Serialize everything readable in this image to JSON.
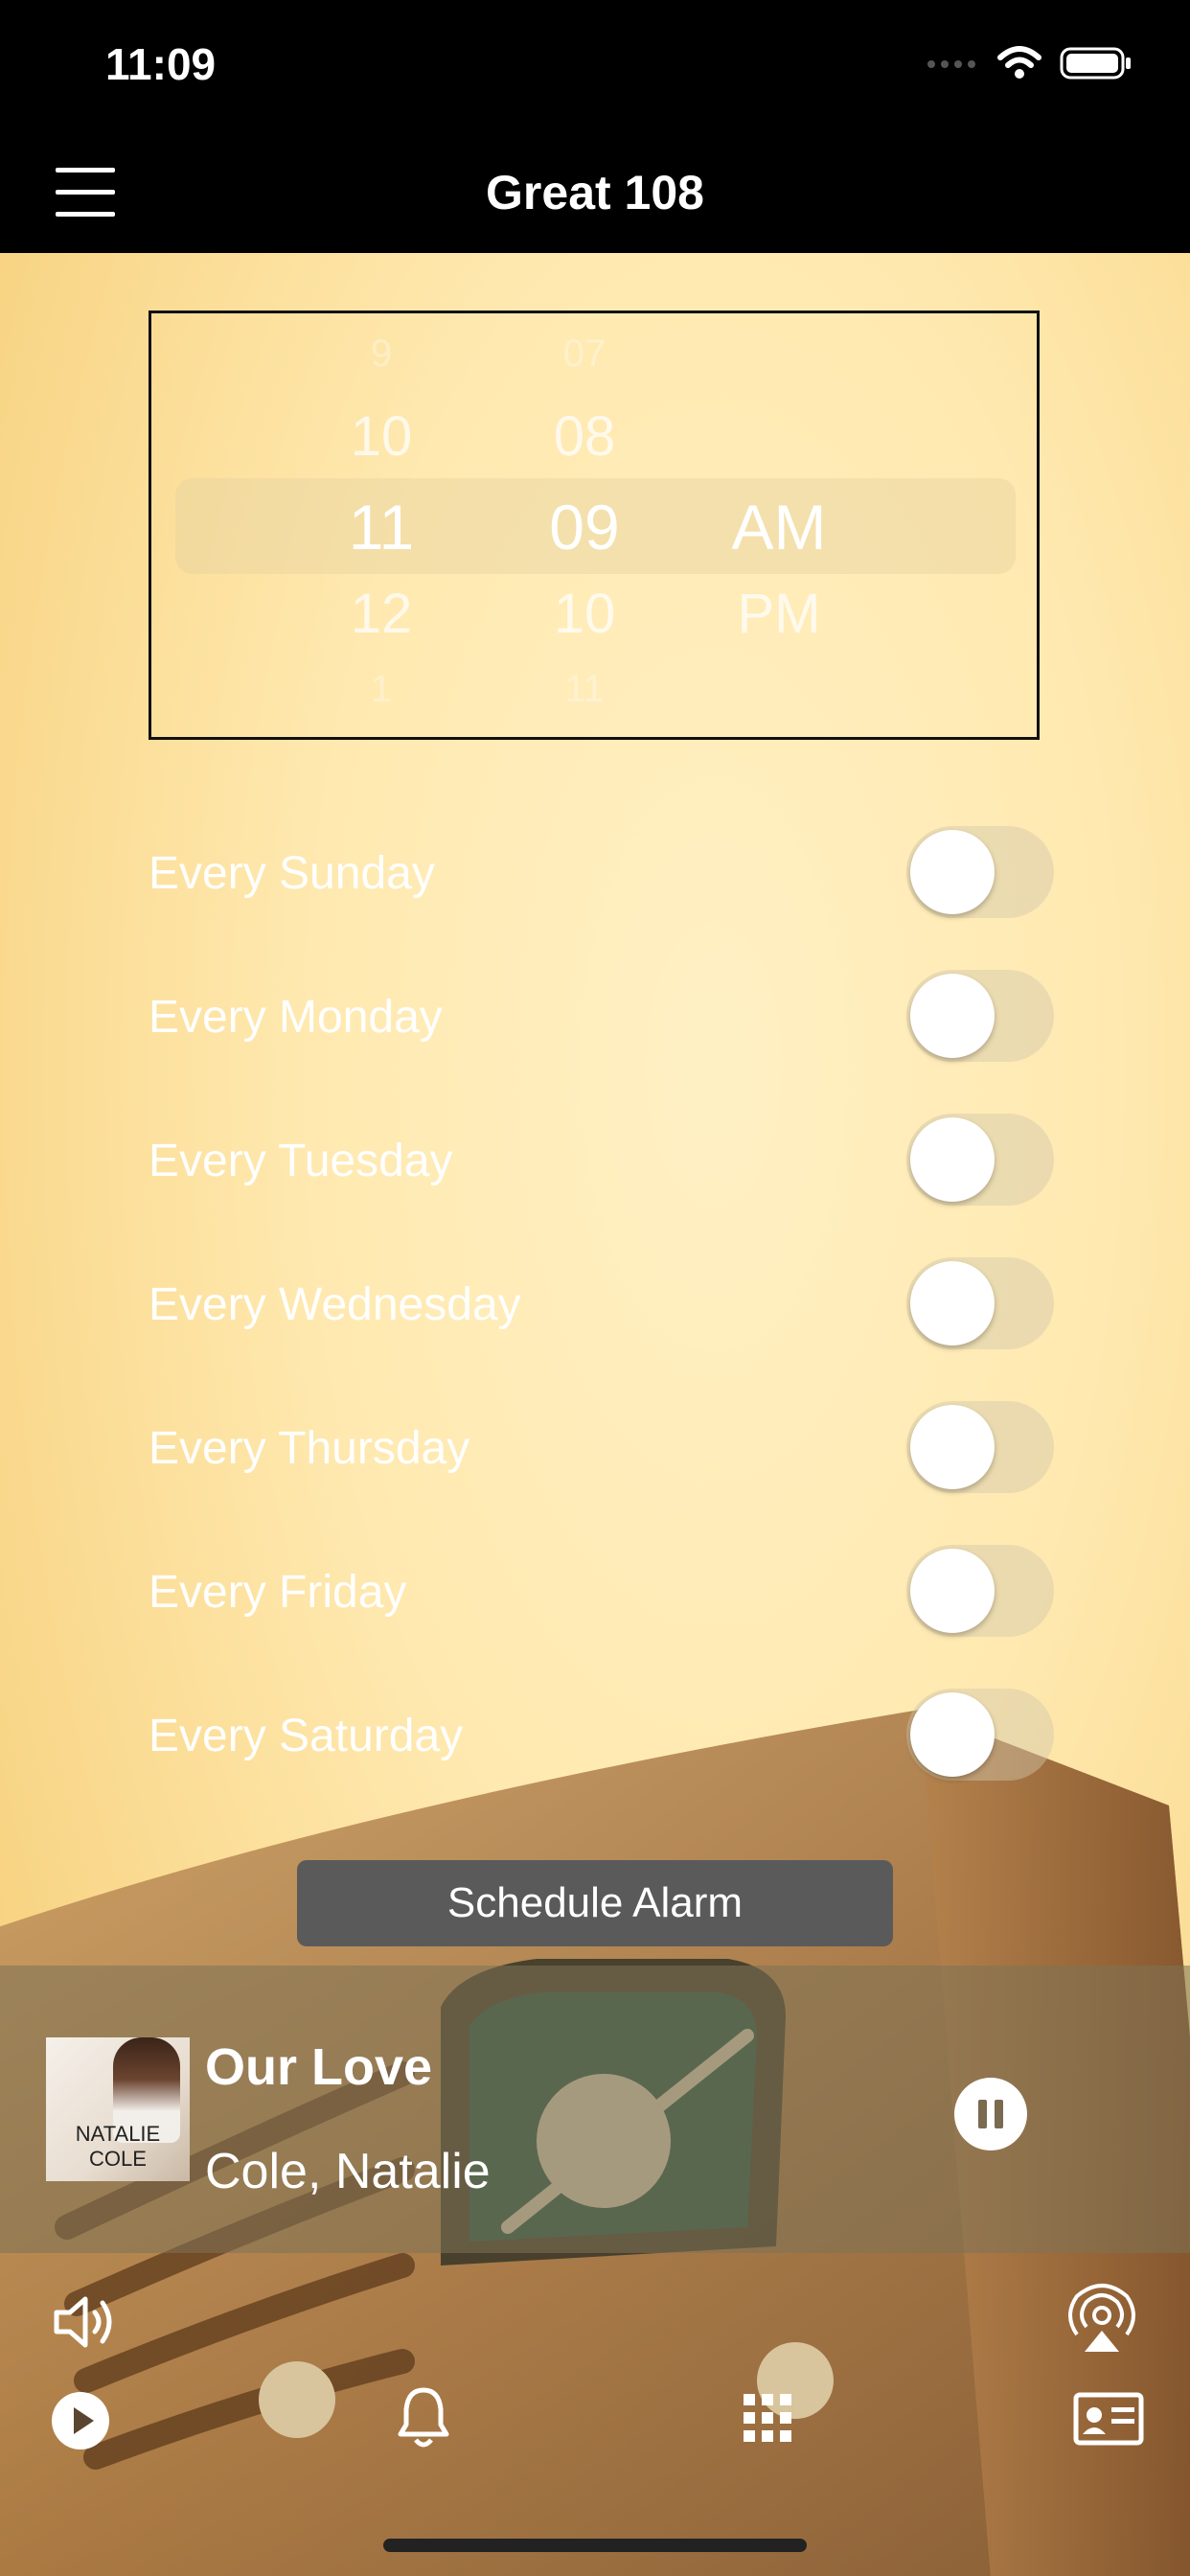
{
  "status": {
    "time": "11:09"
  },
  "header": {
    "title": "Great 108"
  },
  "picker": {
    "hours": [
      "9",
      "10",
      "11",
      "12",
      "1"
    ],
    "minutes": [
      "07",
      "08",
      "09",
      "10",
      "11"
    ],
    "periods": [
      "AM",
      "PM"
    ]
  },
  "schedule": {
    "days": [
      {
        "label": "Every Sunday",
        "enabled": false
      },
      {
        "label": "Every Monday",
        "enabled": false
      },
      {
        "label": "Every Tuesday",
        "enabled": false
      },
      {
        "label": "Every Wednesday",
        "enabled": false
      },
      {
        "label": "Every Thursday",
        "enabled": false
      },
      {
        "label": "Every Friday",
        "enabled": false
      },
      {
        "label": "Every Saturday",
        "enabled": false
      }
    ],
    "button_label": "Schedule Alarm"
  },
  "now_playing": {
    "title": "Our Love",
    "artist": "Cole, Natalie",
    "album_text": "NATALIE COLE",
    "state": "playing"
  },
  "controls": {
    "icons": [
      "volume-icon",
      "airplay-icon",
      "play-icon",
      "bell-icon",
      "grid-icon",
      "contact-card-icon"
    ]
  },
  "colors": {
    "accent": "#ffe9b0",
    "bar": "#000000",
    "button": "#5a5a5a"
  }
}
